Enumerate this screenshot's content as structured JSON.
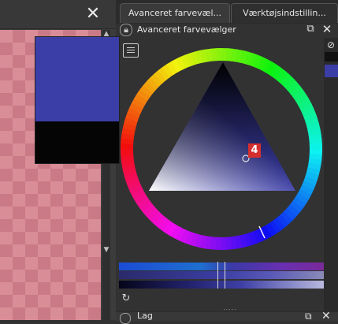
{
  "canvas": {
    "close_glyph": "✕"
  },
  "tabs": [
    {
      "label": "Avanceret farvevæl..."
    },
    {
      "label": "Værktøjsindstillin..."
    }
  ],
  "docker": {
    "title": "Avanceret farvevælger",
    "lock_icon": "lock-icon",
    "float_glyph": "⧉",
    "close_glyph": "✕"
  },
  "colors": {
    "foreground": "#3c3ea8",
    "background": "#050505",
    "accent_badge": "#d42e2e"
  },
  "selector": {
    "hue_marker_label": "",
    "badge": "4"
  },
  "strip": {
    "no_icon_glyph": "⊘"
  },
  "footer": {
    "reset_glyph": "↻",
    "grip": "....."
  },
  "next_docker": {
    "title": "Lag",
    "float_glyph": "⧉",
    "close_glyph": "✕"
  }
}
